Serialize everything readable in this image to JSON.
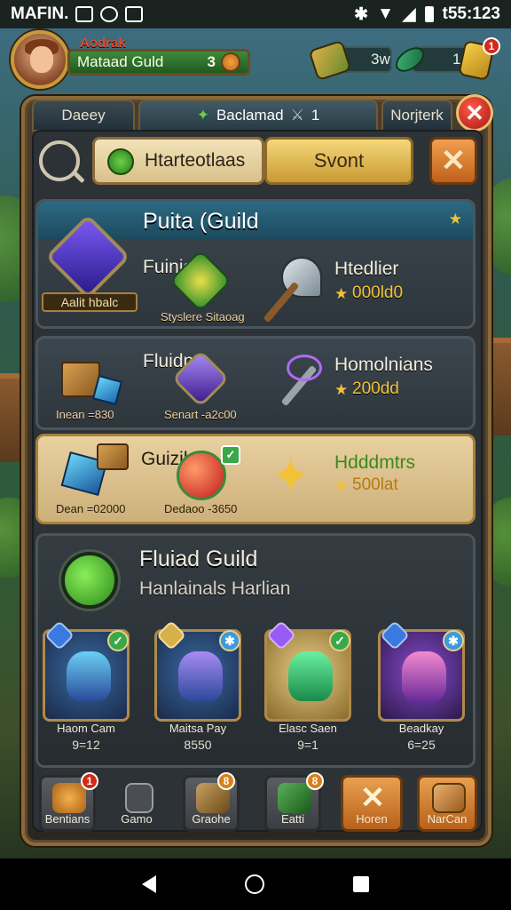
{
  "status_bar": {
    "carrier": "MAFIN.",
    "time": "t55:123"
  },
  "player": {
    "rank": "Aodrak",
    "name": "Mataad Guld",
    "level": "3"
  },
  "resources": [
    {
      "value": "3w",
      "icon": "gold-ore-icon",
      "badge": ""
    },
    {
      "value": "1",
      "icon": "leaf-gem-icon",
      "badge": ""
    },
    {
      "value": "",
      "icon": "gold-bar-icon",
      "badge": "1"
    }
  ],
  "tabs": [
    {
      "label": "Daeey"
    },
    {
      "label": "Baclamad",
      "extra": "1"
    },
    {
      "label": "Norjterk"
    }
  ],
  "toolbar": {
    "primary_label": "Htarteotlaas",
    "secondary_label": "Svont"
  },
  "cards": [
    {
      "title": "Puita (Guild",
      "emblem_label": "Aalit hbalc",
      "item_name": "Fuinio",
      "item_sub": "Styslere Sitaoag",
      "reward_name": "Htedlier",
      "reward_value": "000ld0"
    },
    {
      "item_name": "Fluidn",
      "left_sub": "Inean =830",
      "item_sub": "Senart -a2c00",
      "reward_name": "Homolnians",
      "reward_value": "200dd"
    },
    {
      "item_name": "Guizih",
      "left_sub": "Dean =02000",
      "item_sub": "Dedaoo -3650",
      "reward_name": "Hdddmtrs",
      "reward_value": "500lat"
    }
  ],
  "featured": {
    "title": "Fluiad Guild",
    "subtitle": "Hanlainals Harlian",
    "items": [
      {
        "label": "Haom Cam",
        "count": "9=12"
      },
      {
        "label": "Maitsa Pay",
        "count": "8550"
      },
      {
        "label": "Elasc Saen",
        "count": "9=1"
      },
      {
        "label": "Beadkay",
        "count": "6=25"
      }
    ]
  },
  "bottom_bar": [
    {
      "label": "Bentians",
      "badge": "1"
    },
    {
      "label": "Gamo",
      "badge": ""
    },
    {
      "label": "Graohe",
      "badge": "8"
    },
    {
      "label": "Eatti",
      "badge": "8"
    },
    {
      "label": "Horen",
      "badge": ""
    },
    {
      "label": "NarCan",
      "badge": ""
    }
  ],
  "colors": {
    "accent_gold": "#f3c234",
    "header_teal": "#2c6a82",
    "close_red": "#d02a1a"
  }
}
